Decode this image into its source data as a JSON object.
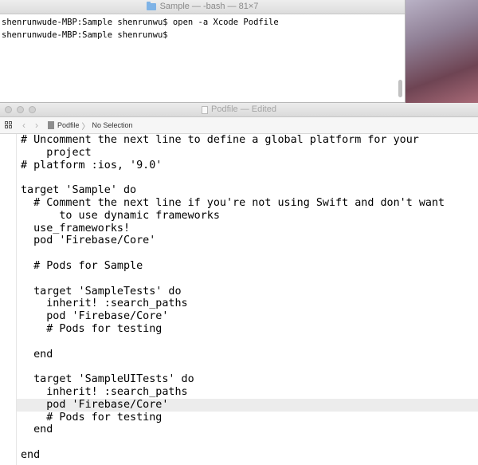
{
  "terminal": {
    "title": "Sample — -bash — 81×7",
    "lines": [
      "shenrunwude-MBP:Sample shenrunwu$ open -a Xcode Podfile",
      "shenrunwude-MBP:Sample shenrunwu$"
    ]
  },
  "xcode": {
    "title": "Podfile — Edited",
    "breadcrumb": {
      "file": "Podfile",
      "selection": "No Selection"
    },
    "code_lines": [
      "# Uncomment the next line to define a global platform for your",
      "    project",
      "# platform :ios, '9.0'",
      "",
      "target 'Sample' do",
      "  # Comment the next line if you're not using Swift and don't want",
      "      to use dynamic frameworks",
      "  use_frameworks!",
      "  pod 'Firebase/Core'",
      "",
      "  # Pods for Sample",
      "",
      "  target 'SampleTests' do",
      "    inherit! :search_paths",
      "    pod 'Firebase/Core'",
      "    # Pods for testing",
      "",
      "  end",
      "",
      "  target 'SampleUITests' do",
      "    inherit! :search_paths",
      "    pod 'Firebase/Core'",
      "    # Pods for testing",
      "  end",
      "",
      "end"
    ],
    "highlighted_line": 21
  }
}
